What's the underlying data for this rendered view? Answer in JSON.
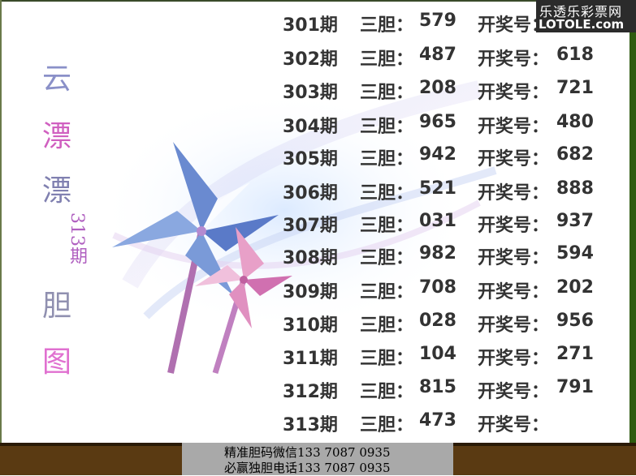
{
  "logo": {
    "line1": "乐透乐彩票网",
    "line2": "LOTOLE.com"
  },
  "title": {
    "chars": [
      "云",
      "漂",
      "漂",
      "胆",
      "图"
    ],
    "period": "313期"
  },
  "labels": {
    "three": "三胆：",
    "draw": "开奖号："
  },
  "rows": [
    {
      "period": "301期",
      "three": "579",
      "draw": ""
    },
    {
      "period": "302期",
      "three": "487",
      "draw": "618"
    },
    {
      "period": "303期",
      "three": "208",
      "draw": "721"
    },
    {
      "period": "304期",
      "three": "965",
      "draw": "480"
    },
    {
      "period": "305期",
      "three": "942",
      "draw": "682"
    },
    {
      "period": "306期",
      "three": "521",
      "draw": "888"
    },
    {
      "period": "307期",
      "three": "031",
      "draw": "937"
    },
    {
      "period": "308期",
      "three": "982",
      "draw": "594"
    },
    {
      "period": "309期",
      "three": "708",
      "draw": "202"
    },
    {
      "period": "310期",
      "three": "028",
      "draw": "956"
    },
    {
      "period": "311期",
      "three": "104",
      "draw": "271"
    },
    {
      "period": "312期",
      "three": "815",
      "draw": "791"
    },
    {
      "period": "313期",
      "three": "473",
      "draw": ""
    }
  ],
  "contact": {
    "line1": "精准胆码微信133  7087  0935",
    "line2": "必赢独胆电话133  7087  0935"
  }
}
